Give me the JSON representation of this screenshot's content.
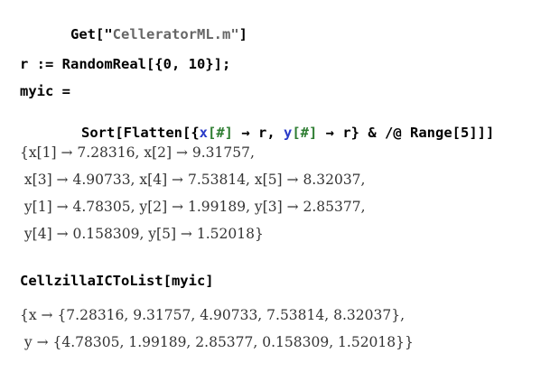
{
  "cell_get": {
    "func": "Get[",
    "quote_open": "\"",
    "filename": "CelleratorML.m",
    "quote_close": "\"",
    "close": "]"
  },
  "cell_define": {
    "line1": "r := RandomReal[{0, 10}];",
    "line2": "myic =",
    "line3": {
      "pre": "Sort[Flatten[{",
      "x": "x",
      "x_slot": "[#]",
      "mid": " → r, ",
      "y": "y",
      "y_slot": "[#]",
      "post": " → r} & /@ Range[5]]]"
    }
  },
  "output_myic": {
    "lines": [
      "{x[1] → 7.28316, x[2] → 9.31757,",
      " x[3] → 4.90733, x[4] → 7.53814, x[5] → 8.32037,",
      " y[1] → 4.78305, y[2] → 1.99189, y[3] → 2.85377,",
      " y[4] → 0.158309, y[5] → 1.52018}"
    ]
  },
  "cell_convert": {
    "text": "CellzillaICToList[myic]"
  },
  "output_list": {
    "lines": [
      "{x → {7.28316, 9.31757, 4.90733, 7.53814, 8.32037},",
      " y → {4.78305, 1.99189, 2.85377, 0.158309, 1.52018}}"
    ]
  },
  "colors": {
    "string": "#666666",
    "symbol_x": "#2a3bc8",
    "symbol_slot": "#2e7d32",
    "output_text": "#333333"
  }
}
